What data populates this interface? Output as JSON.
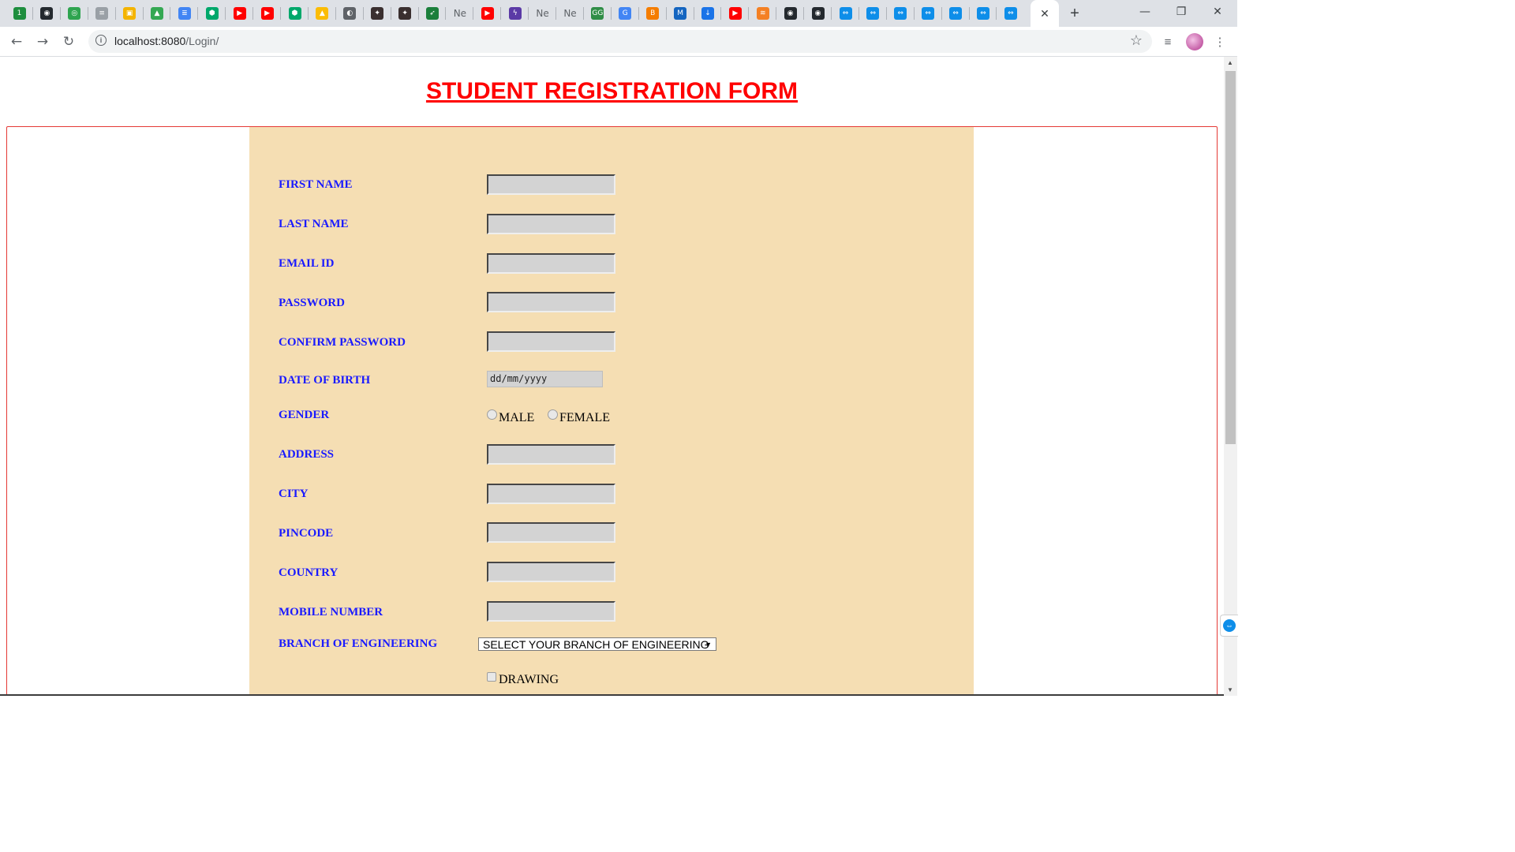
{
  "browser": {
    "tabs": [
      {
        "icon": "badge-1-icon",
        "color": "#1e8e3e",
        "glyph": "1"
      },
      {
        "icon": "github-icon",
        "color": "#24292e",
        "glyph": "◉"
      },
      {
        "icon": "github-outline-icon",
        "color": "#2ea44f",
        "glyph": "◎"
      },
      {
        "icon": "menu-icon",
        "color": "#9aa0a6",
        "glyph": "≡"
      },
      {
        "icon": "folder-icon",
        "color": "#f4b400",
        "glyph": "▣"
      },
      {
        "icon": "google-drive-icon",
        "color": "#34a853",
        "glyph": "▲"
      },
      {
        "icon": "google-docs-icon",
        "color": "#4285f4",
        "glyph": "≣"
      },
      {
        "icon": "shield-icon",
        "color": "#00a86b",
        "glyph": "⬢"
      },
      {
        "icon": "youtube-icon",
        "color": "#ff0000",
        "glyph": "▶"
      },
      {
        "icon": "youtube-icon",
        "color": "#ff0000",
        "glyph": "▶"
      },
      {
        "icon": "shield-icon",
        "color": "#00a86b",
        "glyph": "⬢"
      },
      {
        "icon": "google-drive-icon",
        "color": "#fbbc05",
        "glyph": "▲"
      },
      {
        "icon": "globe-icon",
        "color": "#5f6368",
        "glyph": "◐"
      },
      {
        "icon": "game-icon",
        "color": "#3a2f2f",
        "glyph": "✦"
      },
      {
        "icon": "game-icon",
        "color": "#3a2f2f",
        "glyph": "✦"
      },
      {
        "icon": "rocket-icon",
        "color": "#1b7f3b",
        "glyph": "➶"
      },
      {
        "icon": "text-tab",
        "text": "Ne"
      },
      {
        "icon": "youtube-icon",
        "color": "#ff0000",
        "glyph": "▶"
      },
      {
        "icon": "bolt-icon",
        "color": "#5b3aa6",
        "glyph": "ϟ"
      },
      {
        "icon": "text-tab",
        "text": "Ne"
      },
      {
        "icon": "text-tab",
        "text": "Ne"
      },
      {
        "icon": "geeksforgeeks-icon",
        "color": "#2f8d46",
        "glyph": "GG"
      },
      {
        "icon": "google-icon",
        "color": "#4285f4",
        "glyph": "G"
      },
      {
        "icon": "blogger-icon",
        "color": "#f57d00",
        "glyph": "B"
      },
      {
        "icon": "maven-icon",
        "color": "#1565c0",
        "glyph": "M"
      },
      {
        "icon": "download-icon",
        "color": "#1a73e8",
        "glyph": "↓"
      },
      {
        "icon": "youtube-icon",
        "color": "#ff0000",
        "glyph": "▶"
      },
      {
        "icon": "stackoverflow-icon",
        "color": "#f48024",
        "glyph": "≋"
      },
      {
        "icon": "github-icon",
        "color": "#24292e",
        "glyph": "◉"
      },
      {
        "icon": "github-icon",
        "color": "#24292e",
        "glyph": "◉"
      },
      {
        "icon": "teamviewer-icon",
        "color": "#0e8ee9",
        "glyph": "⇔"
      },
      {
        "icon": "teamviewer-icon",
        "color": "#0e8ee9",
        "glyph": "⇔"
      },
      {
        "icon": "teamviewer-icon",
        "color": "#0e8ee9",
        "glyph": "⇔"
      },
      {
        "icon": "teamviewer-icon",
        "color": "#0e8ee9",
        "glyph": "⇔"
      },
      {
        "icon": "teamviewer-icon",
        "color": "#0e8ee9",
        "glyph": "⇔"
      },
      {
        "icon": "teamviewer-icon",
        "color": "#0e8ee9",
        "glyph": "⇔"
      },
      {
        "icon": "teamviewer-icon",
        "color": "#0e8ee9",
        "glyph": "⇔"
      }
    ],
    "active_tab_close": "✕",
    "new_tab": "+",
    "window": {
      "minimize": "—",
      "restore": "❐",
      "close": "✕"
    },
    "url_host": "localhost:8080",
    "url_path": "/Login/",
    "back": "←",
    "forward": "→",
    "reload": "↻",
    "bookmark_star": "☆"
  },
  "page": {
    "title": "STUDENT REGISTRATION FORM",
    "fields": [
      {
        "label": "FIRST NAME",
        "type": "text",
        "value": ""
      },
      {
        "label": "LAST NAME",
        "type": "text",
        "value": ""
      },
      {
        "label": "EMAIL ID",
        "type": "text",
        "value": ""
      },
      {
        "label": "PASSWORD",
        "type": "password",
        "value": ""
      },
      {
        "label": "CONFIRM PASSWORD",
        "type": "password",
        "value": ""
      }
    ],
    "dob": {
      "label": "DATE OF BIRTH",
      "placeholder": "dd/mm/yyyy"
    },
    "gender": {
      "label": "GENDER",
      "options": [
        "MALE",
        "FEMALE"
      ]
    },
    "fields2": [
      {
        "label": "ADDRESS",
        "type": "text",
        "value": ""
      },
      {
        "label": "CITY",
        "type": "text",
        "value": ""
      },
      {
        "label": "PINCODE",
        "type": "text",
        "value": ""
      },
      {
        "label": "COUNTRY",
        "type": "text",
        "value": ""
      },
      {
        "label": "MOBILE NUMBER",
        "type": "text",
        "value": ""
      }
    ],
    "branch": {
      "label": "BRANCH OF ENGINEERING",
      "selected": "SELECT YOUR BRANCH OF ENGINEERING"
    },
    "hobbies": {
      "options": [
        "DRAWING"
      ]
    }
  },
  "colors": {
    "title": "#ff0000",
    "label": "#1a1aff",
    "panel": "#f5deb3",
    "input": "#d3d3d3",
    "border": "#e53935"
  }
}
